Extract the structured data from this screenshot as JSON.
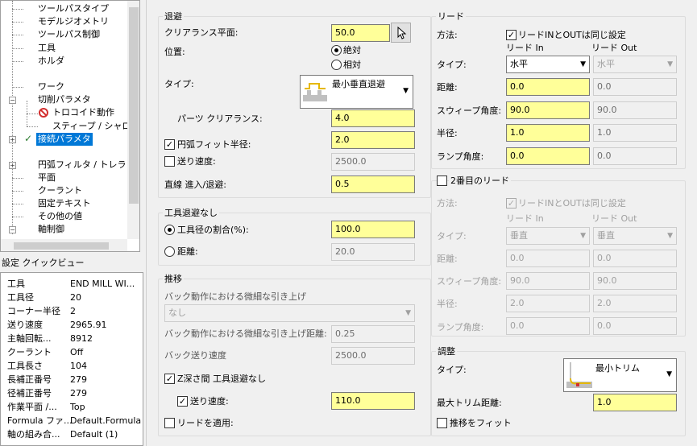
{
  "tree": {
    "items": [
      {
        "label": "ツールパスタイプ"
      },
      {
        "label": "モデルジオメトリ"
      },
      {
        "label": "ツールパス制御"
      },
      {
        "label": "工具"
      },
      {
        "label": "ホルダ"
      },
      {
        "label": "ワーク"
      },
      {
        "label": "切削パラメタ"
      },
      {
        "label": "トロコイド動作"
      },
      {
        "label": "スティープ / シャロー"
      },
      {
        "label": "接続パラメタ"
      },
      {
        "label": "円弧フィルタ / トレランス"
      },
      {
        "label": "平面"
      },
      {
        "label": "クーラント"
      },
      {
        "label": "固定テキスト"
      },
      {
        "label": "その他の値"
      },
      {
        "label": "軸制御"
      }
    ],
    "selected": "接続パラメタ",
    "selection_color": "#0078d7"
  },
  "quickview": {
    "title": "設定 クイックビュー",
    "rows": [
      {
        "key": "工具",
        "value": "END MILL WI..."
      },
      {
        "key": "工具径",
        "value": "20"
      },
      {
        "key": "コーナー半径",
        "value": "2"
      },
      {
        "key": "送り速度",
        "value": "2965.91"
      },
      {
        "key": "主軸回転...",
        "value": "8912"
      },
      {
        "key": "クーラント",
        "value": "Off"
      },
      {
        "key": "工具長さ",
        "value": "104"
      },
      {
        "key": "長補正番号",
        "value": "279"
      },
      {
        "key": "径補正番号",
        "value": "279"
      },
      {
        "key": "作業平面 /...",
        "value": "Top"
      },
      {
        "key": "Formula ファ...",
        "value": "Default.Formula"
      },
      {
        "key": "軸の組み合...",
        "value": "Default (1)"
      }
    ]
  },
  "retract": {
    "title": "退避",
    "clearance_label": "クリアランス平面:",
    "clearance_value": "50.0",
    "position_label": "位置:",
    "absolute_label": "絶対",
    "relative_label": "相対",
    "type_label": "タイプ:",
    "type_value": "最小垂直退避",
    "parts_clearance_label": "パーツ クリアランス:",
    "parts_clearance_value": "4.0",
    "arc_fit_label": "円弧フィット半径:",
    "arc_fit_value": "2.0",
    "feed_label": "送り速度:",
    "feed_value": "2500.0",
    "linear_label": "直線 進入/退避:",
    "linear_value": "0.5"
  },
  "no_retract": {
    "title": "工具退避なし",
    "percent_label": "工具径の割合(%):",
    "percent_value": "100.0",
    "distance_label": "距離:",
    "distance_value": "20.0"
  },
  "transition": {
    "title": "推移",
    "micro_lift_label": "バック動作における微細な引き上げ",
    "micro_lift_value": "なし",
    "micro_lift_dist_label": "バック動作における微細な引き上げ距離:",
    "micro_lift_dist_value": "0.25",
    "back_feed_label": "バック送り速度",
    "back_feed_value": "2500.0",
    "z_step_label": "Z深さ間 工具退避なし",
    "feed_label": "送り速度:",
    "feed_value": "110.0",
    "apply_lead_label": "リードを適用:"
  },
  "lead": {
    "title": "リード",
    "method_label": "方法:",
    "same_label": "リードINとOUTは同じ設定",
    "lead_in_label": "リード In",
    "lead_out_label": "リード Out",
    "type_label": "タイプ:",
    "type_in": "水平",
    "type_out": "水平",
    "distance_label": "距離:",
    "distance_in": "0.0",
    "distance_out": "0.0",
    "sweep_label": "スウィープ角度:",
    "sweep_in": "90.0",
    "sweep_out": "90.0",
    "radius_label": "半径:",
    "radius_in": "1.0",
    "radius_out": "1.0",
    "ramp_label": "ランプ角度:",
    "ramp_in": "0.0",
    "ramp_out": "0.0"
  },
  "lead2": {
    "title": "2番目のリード",
    "method_label": "方法:",
    "same_label": "リードINとOUTは同じ設定",
    "lead_in_label": "リード In",
    "lead_out_label": "リード Out",
    "type_label": "タイプ:",
    "type_in": "垂直",
    "type_out": "垂直",
    "distance_label": "距離:",
    "distance_in": "0.0",
    "distance_out": "0.0",
    "sweep_label": "スウィープ角度:",
    "sweep_in": "90.0",
    "sweep_out": "90.0",
    "radius_label": "半径:",
    "radius_in": "2.0",
    "radius_out": "2.0",
    "ramp_label": "ランプ角度:",
    "ramp_in": "0.0",
    "ramp_out": "0.0"
  },
  "adjust": {
    "title": "調整",
    "type_label": "タイプ:",
    "type_value": "最小トリム",
    "max_trim_label": "最大トリム距離:",
    "max_trim_value": "1.0",
    "fit_label": "推移をフィット"
  },
  "colors": {
    "input_highlight": "#ffff99",
    "panel_bg": "#f0f0f0"
  }
}
